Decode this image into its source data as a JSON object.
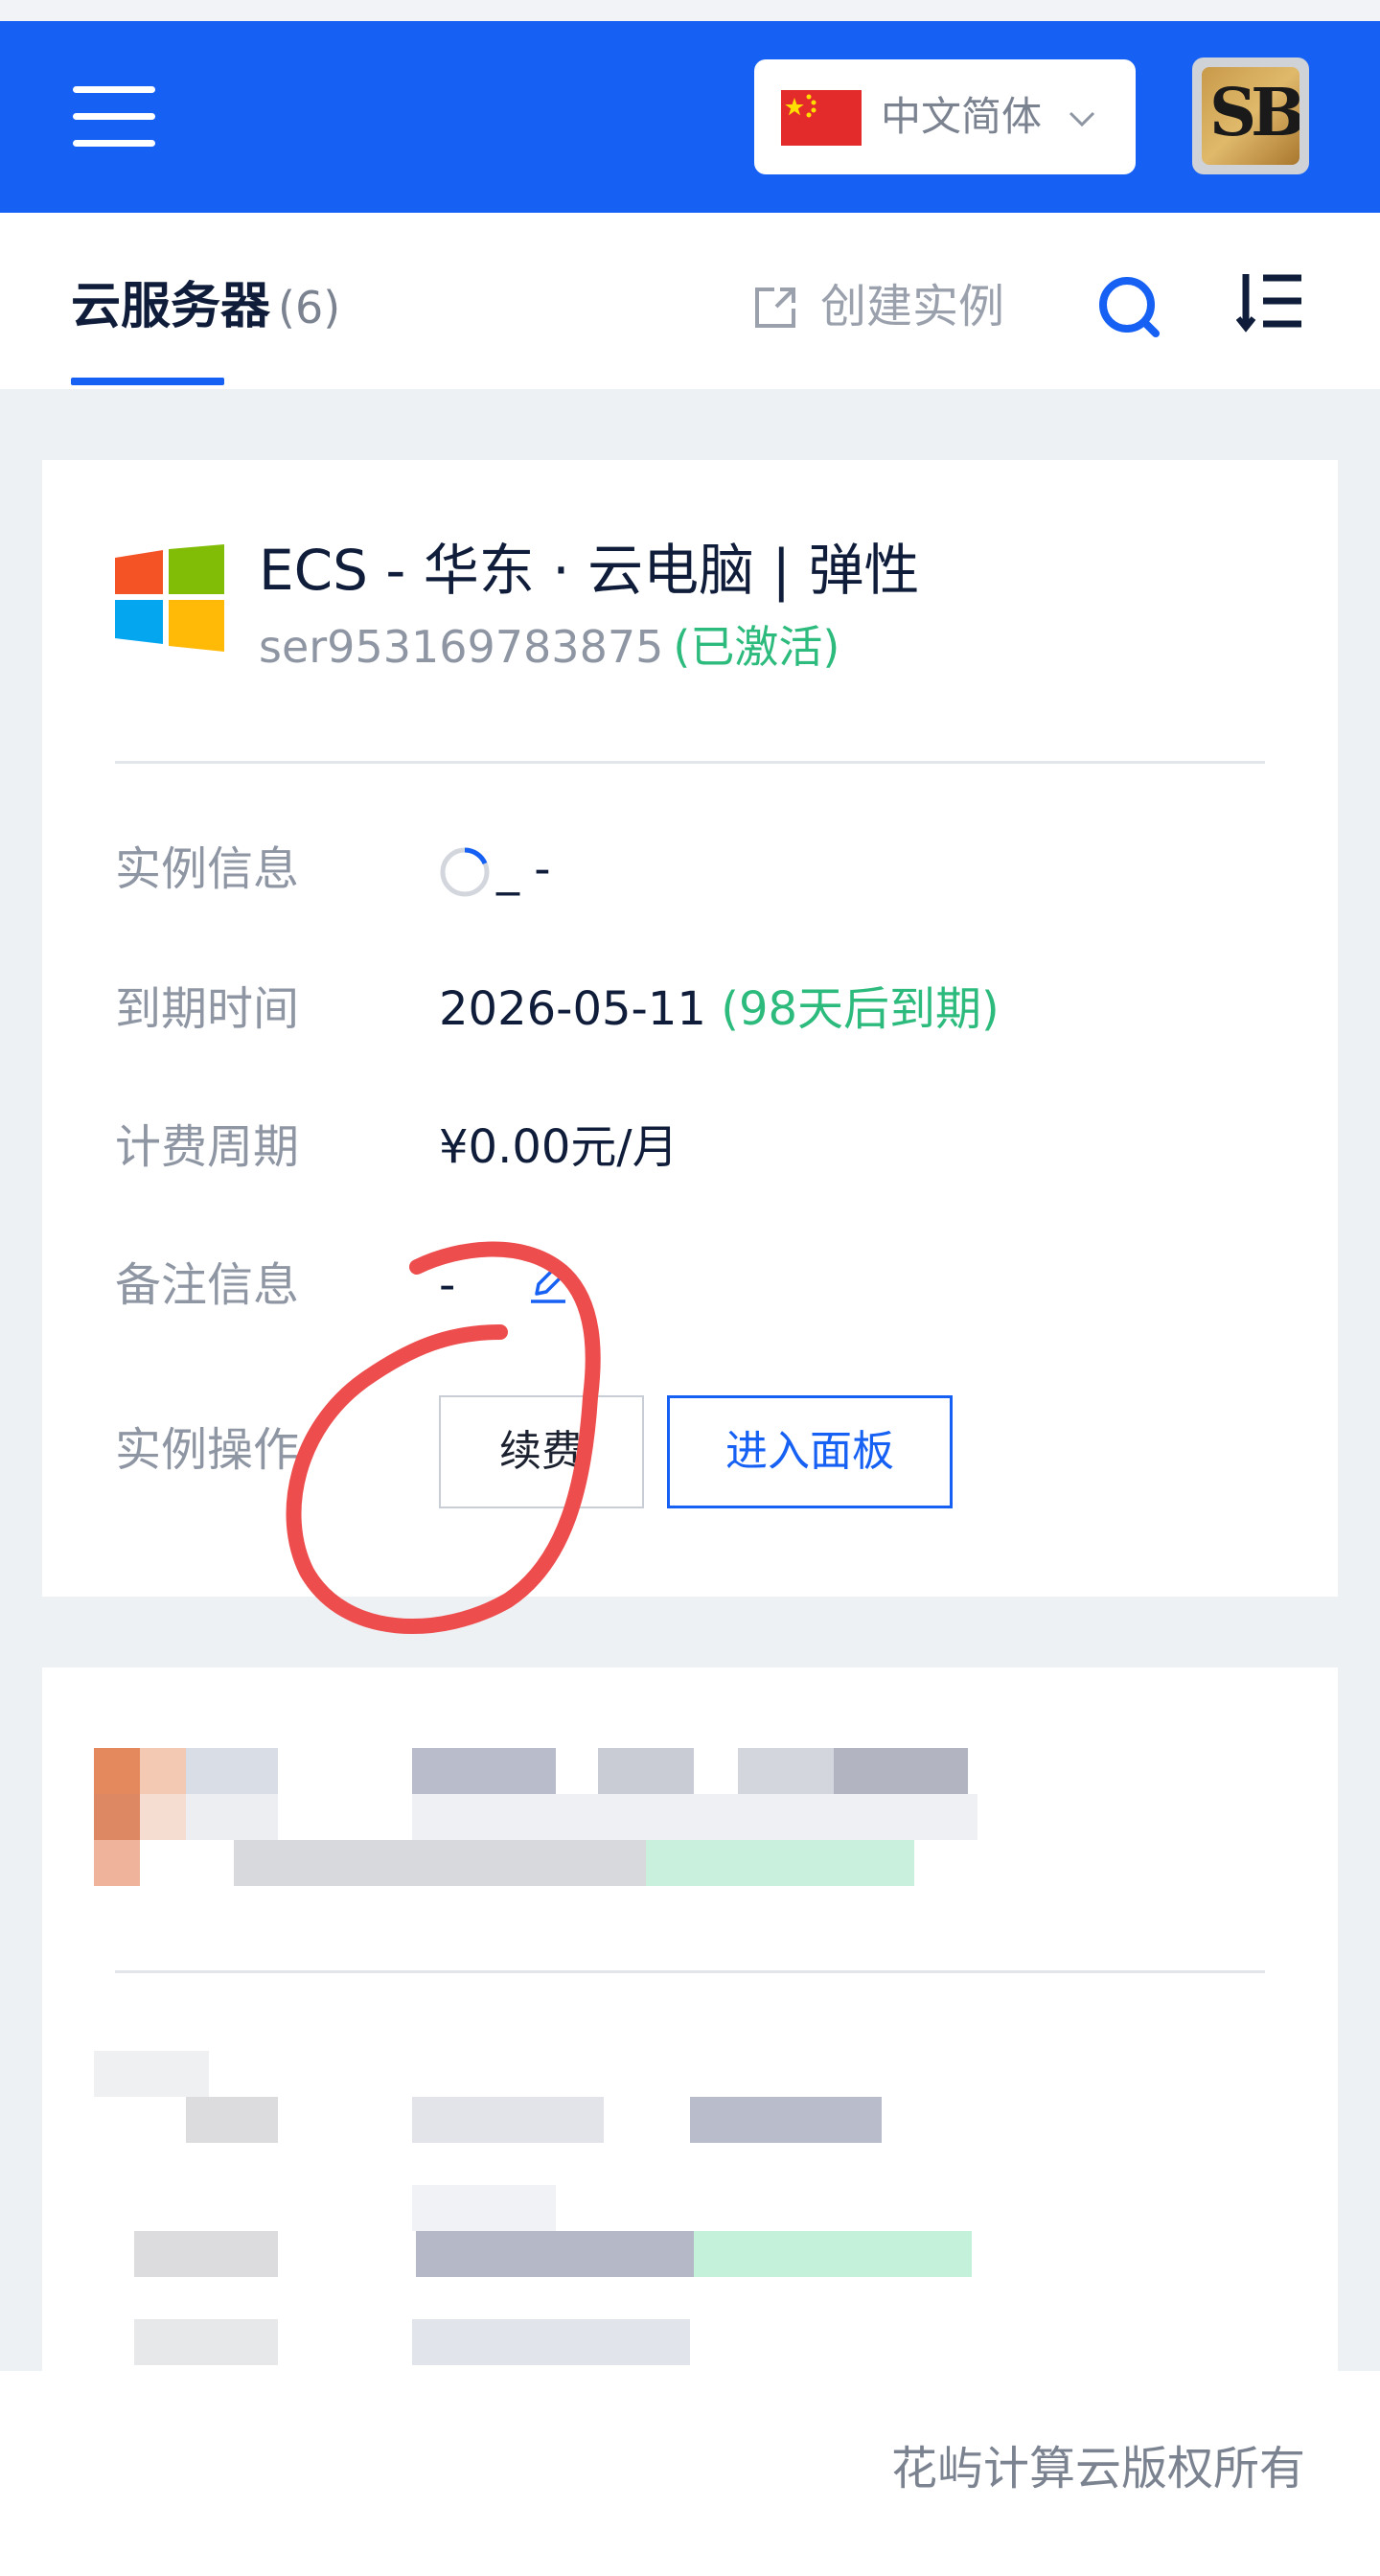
{
  "header": {
    "language_label": "中文简体"
  },
  "tabs": {
    "active_label": "云服务器",
    "active_count": "(6)",
    "create_label": "创建实例"
  },
  "card": {
    "title": "ECS - 华东 · 云电脑 | 弹性",
    "server_id": "ser953169783875",
    "status": "(已激活)",
    "rows": {
      "info_label": "实例信息",
      "info_value": "_ -",
      "expire_label": "到期时间",
      "expire_date": "2026-05-11",
      "expire_note": "(98天后到期)",
      "billing_label": "计费周期",
      "billing_value": "¥0.00元/月",
      "remark_label": "备注信息",
      "remark_value": "-",
      "ops_label": "实例操作"
    },
    "buttons": {
      "renew": "续费",
      "panel": "进入面板"
    }
  },
  "footer": {
    "copyright": "花屿计算云版权所有"
  },
  "colors": {
    "primary": "#1661f4",
    "success": "#2dbb7d",
    "annotation": "#ee4d4d"
  },
  "icons": [
    "menu-icon",
    "china-flag-icon",
    "chevron-down-icon",
    "create-icon",
    "search-icon",
    "sort-icon",
    "windows-logo-icon",
    "spinner-icon",
    "edit-icon"
  ]
}
